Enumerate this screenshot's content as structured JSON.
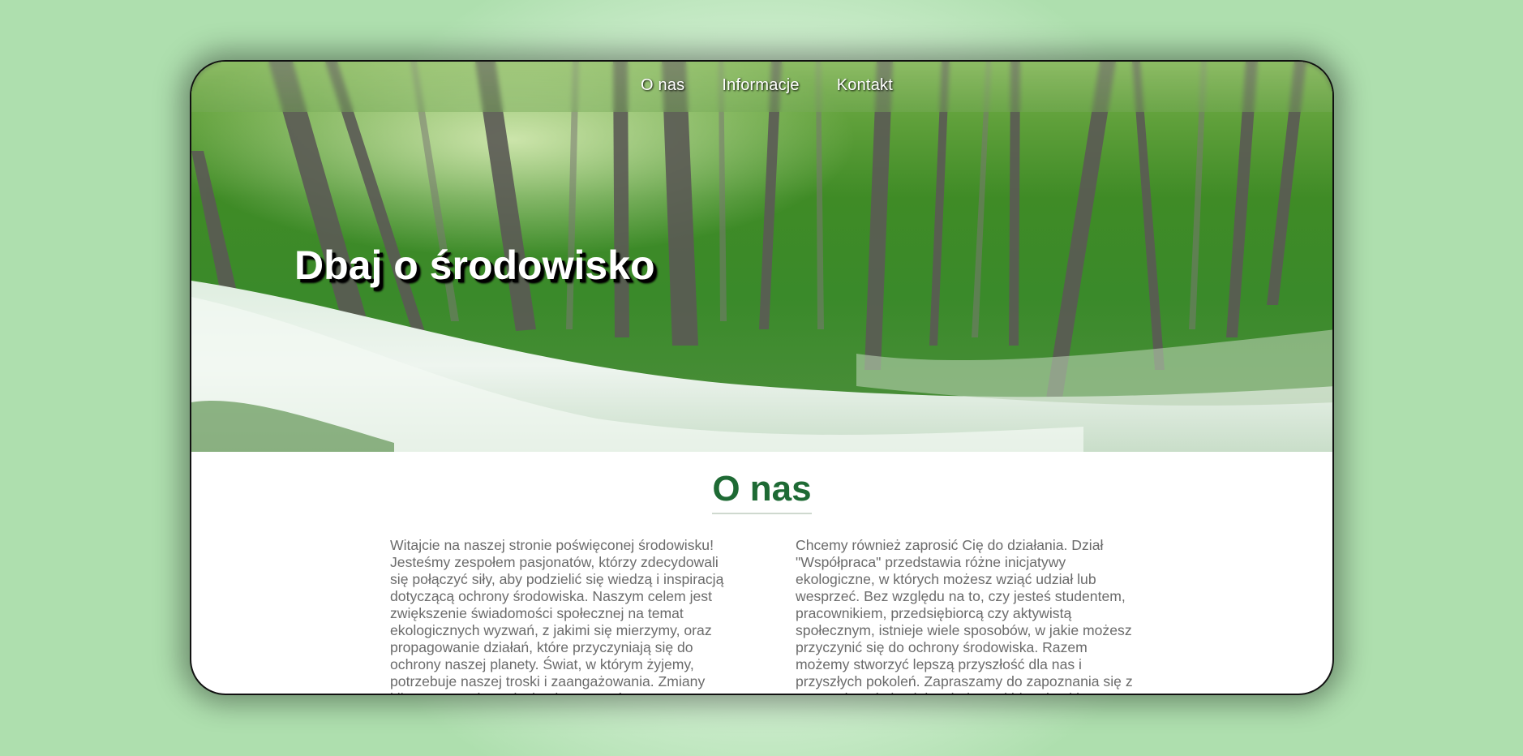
{
  "nav": {
    "items": [
      "O nas",
      "Informacje",
      "Kontakt"
    ]
  },
  "hero": {
    "title": "Dbaj o środowisko"
  },
  "about": {
    "heading": "O nas",
    "left_text": "Witajcie na naszej stronie poświęconej środowisku! Jesteśmy zespołem pasjonatów, którzy zdecydowali się połączyć siły, aby podzielić się wiedzą i inspiracją dotyczącą ochrony środowiska. Naszym celem jest zwiększenie świadomości społecznej na temat ekologicznych wyzwań, z jakimi się mierzymy, oraz propagowanie działań, które przyczyniają się do ochrony naszej planety. Świat, w którym żyjemy, potrzebuje naszej troski i zaangażowania. Zmiany klimatyczne, degradacja ekosystemów",
    "right_text": "Chcemy również zaprosić Cię do działania. Dział \"Współpraca\" przedstawia różne inicjatywy ekologiczne, w których możesz wziąć udział lub wesprzeć. Bez względu na to, czy jesteś studentem, pracownikiem, przedsiębiorcą czy aktywistą społecznym, istnieje wiele sposobów, w jakie możesz przyczynić się do ochrony środowiska. Razem możemy stworzyć lepszą przyszłość dla nas i przyszłych pokoleń. Zapraszamy do zapoznania się z naszymi artykułami, inspirującymi historiami i"
  },
  "colors": {
    "heading": "#1e6a34",
    "body_text": "#6b6b6b",
    "background": "#aedfae"
  }
}
